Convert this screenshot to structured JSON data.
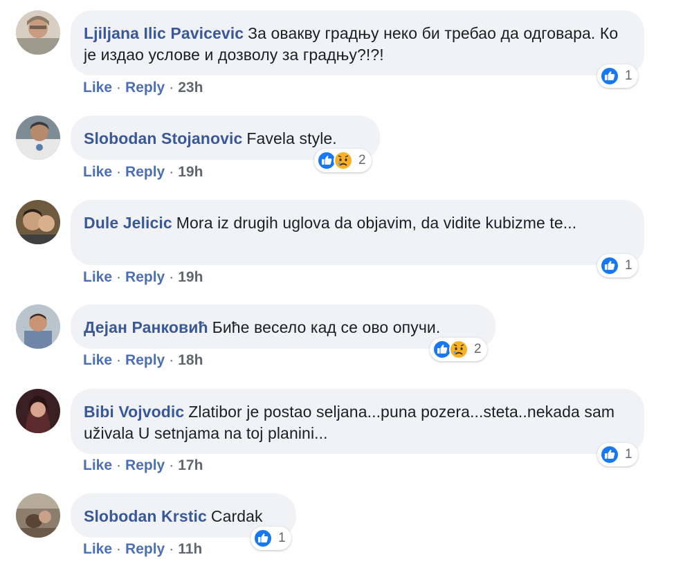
{
  "colors": {
    "author": "#385898",
    "bubble": "#f0f2f5",
    "like_blue": "#1877f2",
    "sad_yellow": "#f7b125",
    "meta_gray": "#606770"
  },
  "actions": {
    "like": "Like",
    "reply": "Reply",
    "dot": "·"
  },
  "comments": [
    {
      "author": "Ljiljana Ilic Pavicevic",
      "text": "За овакву градњу неко би требао да одговара. Ко је издао услове и дозволу за градњу?!?!",
      "time": "23h",
      "reactions": [
        "like-icon"
      ],
      "reaction_count": "1"
    },
    {
      "author": "Slobodan Stojanovic",
      "text": "Favela style.",
      "time": "19h",
      "reactions": [
        "like-icon",
        "sad-icon"
      ],
      "reaction_count": "2"
    },
    {
      "author": "Dule Jelicic",
      "text": "Mora iz drugih uglova da objavim, da vidite kubizme te...",
      "time": "19h",
      "reactions": [
        "like-icon"
      ],
      "reaction_count": "1"
    },
    {
      "author": "Дејан Ранковић",
      "text": "Биће весело кад се ово опучи.",
      "time": "18h",
      "reactions": [
        "like-icon",
        "sad-icon"
      ],
      "reaction_count": "2"
    },
    {
      "author": "Bibi Vojvodic",
      "text": "Zlatibor je postao seljana...puna pozera...steta..nekada sam uživala U setnjama na toj planini...",
      "time": "17h",
      "reactions": [
        "like-icon"
      ],
      "reaction_count": "1"
    },
    {
      "author": "Slobodan Krstic",
      "text": "Cardak",
      "time": "11h",
      "reactions": [
        "like-icon"
      ],
      "reaction_count": "1"
    }
  ]
}
